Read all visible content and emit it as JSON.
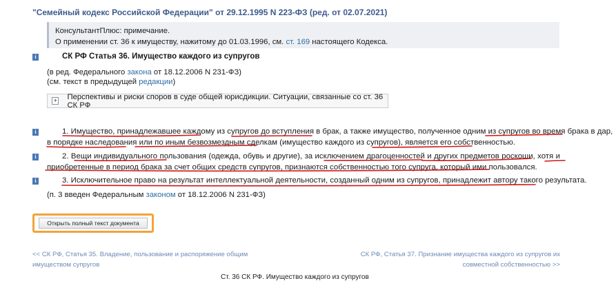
{
  "header": {
    "link_text": "\"Семейный кодекс Российской Федерации\"",
    "rest_text": " от 29.12.1995 N 223-ФЗ (ред. от 02.07.2021)"
  },
  "note": {
    "title": "КонсультантПлюс: примечание.",
    "text_before": "О применении ст. 36 к имуществу, нажитому до 01.03.1996, см. ",
    "link": "ст. 169",
    "text_after": " настоящего Кодекса."
  },
  "icon_label": "i",
  "article": {
    "title": "СК РФ Статья 36. Имущество каждого из супругов",
    "edition_before": "(в ред. Федерального ",
    "edition_link": "закона",
    "edition_after": " от 18.12.2006 N 231-ФЗ)",
    "prev_before": "(см. текст в предыдущей ",
    "prev_link": "редакции",
    "prev_after": ")"
  },
  "collapsible": {
    "label": "Перспективы и риски споров в суде общей юрисдикции. Ситуации, связанные со ст. 36 СК РФ"
  },
  "paragraphs": {
    "p1_line1": "1. Имущество, принадлежавшее каждому из супругов до вступления в брак, а также имущество, полученное одним из супругов во время брака в дар,",
    "p1_line2": "в порядке наследования или по иным безвозмездным сделкам (имущество каждого из супругов), является его собственностью.",
    "p2_line1": "2. Вещи индивидуального пользования (одежда, обувь и другие), за исключением драгоценностей и других предметов роскоши, хотя и",
    "p2_line2": "приобретенные в период брака за счет общих средств супругов, признаются собственностью того супруга, который ими пользовался.",
    "p3_line1": "3. Исключительное право на результат интеллектуальной деятельности, созданный одним из супругов, принадлежит автору такого результата.",
    "p3_note_before": "(п. 3 введен Федеральным ",
    "p3_note_link": "законом",
    "p3_note_after": " от 18.12.2006 N 231-ФЗ)"
  },
  "button": {
    "label": "Открыть полный текст документа"
  },
  "nav": {
    "prev_line1": "<< СК РФ, Статья 35. Владение, пользование и распоряжение общим",
    "prev_line2": "имуществом супругов",
    "next_line1": "СК РФ, Статья 37. Признание имущества каждого из супругов их",
    "next_line2": "совместной собственностью >>"
  },
  "footer_cut": "Ст. 36 СК РФ. Имущество каждого из супругов",
  "colors": {
    "link": "#2e6da4",
    "underline": "#d11515",
    "button_border": "#f3a33b",
    "icon": "#4b77b6"
  }
}
